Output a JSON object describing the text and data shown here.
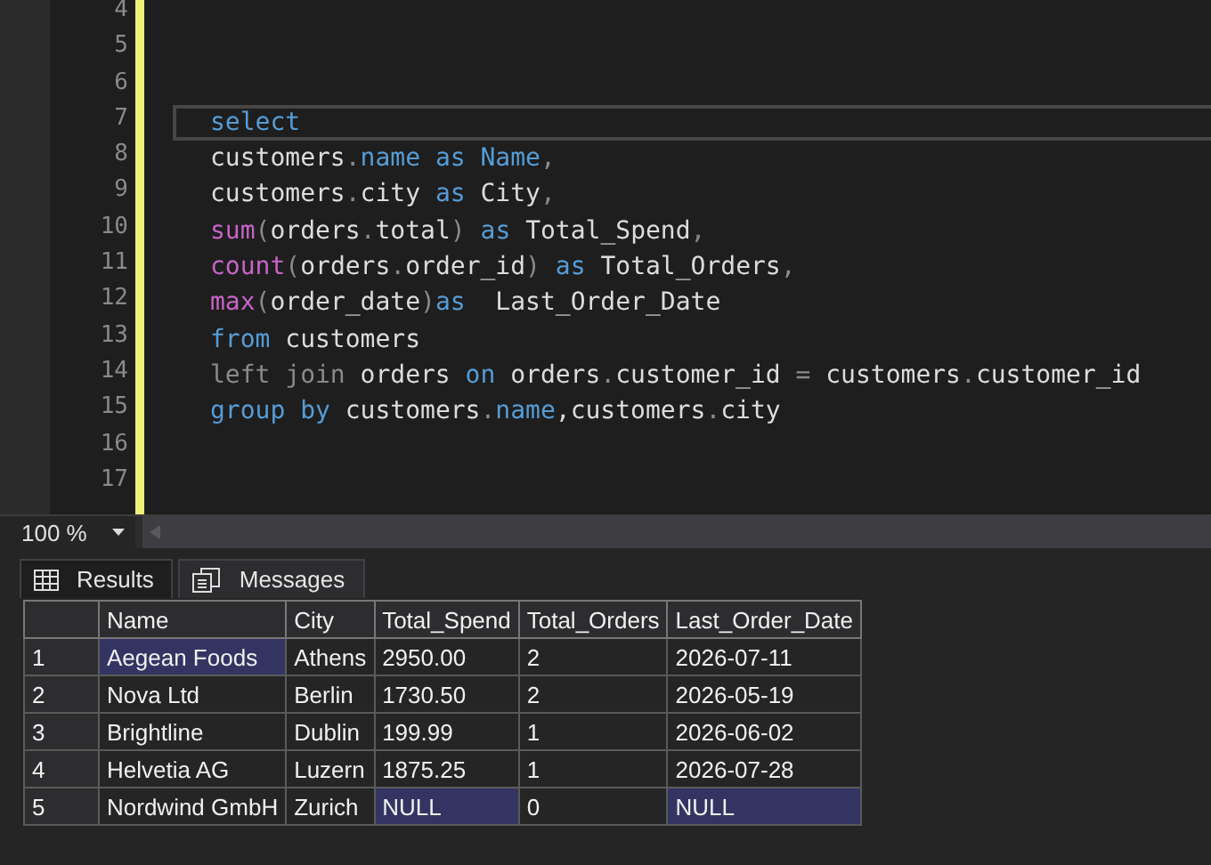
{
  "editor": {
    "lines": [
      {
        "number": "4",
        "current": false
      },
      {
        "number": "5",
        "current": false
      },
      {
        "number": "6",
        "current": false
      },
      {
        "number": "7",
        "current": true,
        "tokens": [
          {
            "text": "select",
            "kind": "kw"
          }
        ]
      },
      {
        "number": "8",
        "current": false,
        "tokens": [
          {
            "text": "customers",
            "kind": "id"
          },
          {
            "text": ".",
            "kind": "op"
          },
          {
            "text": "name",
            "kind": "kw"
          },
          {
            "text": " as",
            "kind": "kw"
          },
          {
            "text": " Name",
            "kind": "kw"
          },
          {
            "text": ",",
            "kind": "op"
          }
        ]
      },
      {
        "number": "9",
        "current": false,
        "tokens": [
          {
            "text": "customers",
            "kind": "id"
          },
          {
            "text": ".",
            "kind": "op"
          },
          {
            "text": "city ",
            "kind": "id"
          },
          {
            "text": "as",
            "kind": "kw"
          },
          {
            "text": " City",
            "kind": "id"
          },
          {
            "text": ",",
            "kind": "op"
          }
        ]
      },
      {
        "number": "10",
        "current": false,
        "tokens": [
          {
            "text": "sum",
            "kind": "fn"
          },
          {
            "text": "(",
            "kind": "op"
          },
          {
            "text": "orders",
            "kind": "id"
          },
          {
            "text": ".",
            "kind": "op"
          },
          {
            "text": "total",
            "kind": "id"
          },
          {
            "text": ")",
            "kind": "op"
          },
          {
            "text": " as",
            "kind": "kw"
          },
          {
            "text": " Total_Spend",
            "kind": "id"
          },
          {
            "text": ",",
            "kind": "op"
          }
        ]
      },
      {
        "number": "11",
        "current": false,
        "tokens": [
          {
            "text": "count",
            "kind": "fn"
          },
          {
            "text": "(",
            "kind": "op"
          },
          {
            "text": "orders",
            "kind": "id"
          },
          {
            "text": ".",
            "kind": "op"
          },
          {
            "text": "order_id",
            "kind": "id"
          },
          {
            "text": ")",
            "kind": "op"
          },
          {
            "text": " as",
            "kind": "kw"
          },
          {
            "text": " Total_Orders",
            "kind": "id"
          },
          {
            "text": ",",
            "kind": "op"
          }
        ]
      },
      {
        "number": "12",
        "current": false,
        "tokens": [
          {
            "text": "max",
            "kind": "fn"
          },
          {
            "text": "(",
            "kind": "op"
          },
          {
            "text": "order_date",
            "kind": "id"
          },
          {
            "text": ")",
            "kind": "op"
          },
          {
            "text": "as",
            "kind": "kw"
          },
          {
            "text": "  Last_Order_Date",
            "kind": "id"
          }
        ]
      },
      {
        "number": "13",
        "current": false,
        "tokens": [
          {
            "text": "from",
            "kind": "kw"
          },
          {
            "text": " customers",
            "kind": "id"
          }
        ]
      },
      {
        "number": "14",
        "current": false,
        "tokens": [
          {
            "text": "left join",
            "kind": "gray"
          },
          {
            "text": " orders ",
            "kind": "id"
          },
          {
            "text": "on",
            "kind": "kw"
          },
          {
            "text": " orders",
            "kind": "id"
          },
          {
            "text": ".",
            "kind": "op"
          },
          {
            "text": "customer_id ",
            "kind": "id"
          },
          {
            "text": "=",
            "kind": "op"
          },
          {
            "text": " customers",
            "kind": "id"
          },
          {
            "text": ".",
            "kind": "op"
          },
          {
            "text": "customer_id",
            "kind": "id"
          }
        ]
      },
      {
        "number": "15",
        "current": false,
        "tokens": [
          {
            "text": "group by",
            "kind": "kw"
          },
          {
            "text": " customers",
            "kind": "id"
          },
          {
            "text": ".",
            "kind": "op"
          },
          {
            "text": "name",
            "kind": "kw"
          },
          {
            "text": ",customers",
            "kind": "id"
          },
          {
            "text": ".",
            "kind": "op"
          },
          {
            "text": "city",
            "kind": "id"
          }
        ]
      },
      {
        "number": "16",
        "current": false
      },
      {
        "number": "17",
        "current": false
      }
    ]
  },
  "zoom": "100 %",
  "tabs": [
    {
      "label": "Results",
      "selected": true
    },
    {
      "label": "Messages",
      "selected": false
    }
  ],
  "table": {
    "columns": [
      "Name",
      "City",
      "Total_Spend",
      "Total_Orders",
      "Last_Order_Date"
    ],
    "rows": [
      {
        "number": "1",
        "cells": [
          {
            "text": "Aegean Foods",
            "selected": true
          },
          {
            "text": "Athens",
            "selected": false
          },
          {
            "text": "2950.00",
            "selected": false
          },
          {
            "text": "2",
            "selected": false
          },
          {
            "text": "2026-07-11",
            "selected": false
          }
        ]
      },
      {
        "number": "2",
        "cells": [
          {
            "text": "Nova Ltd",
            "selected": false
          },
          {
            "text": "Berlin",
            "selected": false
          },
          {
            "text": "1730.50",
            "selected": false
          },
          {
            "text": "2",
            "selected": false
          },
          {
            "text": "2026-05-19",
            "selected": false
          }
        ]
      },
      {
        "number": "3",
        "cells": [
          {
            "text": "Brightline",
            "selected": false
          },
          {
            "text": "Dublin",
            "selected": false
          },
          {
            "text": "199.99",
            "selected": false
          },
          {
            "text": "1",
            "selected": false
          },
          {
            "text": "2026-06-02",
            "selected": false
          }
        ]
      },
      {
        "number": "4",
        "cells": [
          {
            "text": "Helvetia AG",
            "selected": false
          },
          {
            "text": "Luzern",
            "selected": false
          },
          {
            "text": "1875.25",
            "selected": false
          },
          {
            "text": "1",
            "selected": false
          },
          {
            "text": "2026-07-28",
            "selected": false
          }
        ]
      },
      {
        "number": "5",
        "cells": [
          {
            "text": "Nordwind GmbH",
            "selected": false
          },
          {
            "text": "Zurich",
            "selected": false
          },
          {
            "text": "NULL",
            "selected": true
          },
          {
            "text": "0",
            "selected": false
          },
          {
            "text": "NULL",
            "selected": true
          }
        ]
      }
    ]
  }
}
